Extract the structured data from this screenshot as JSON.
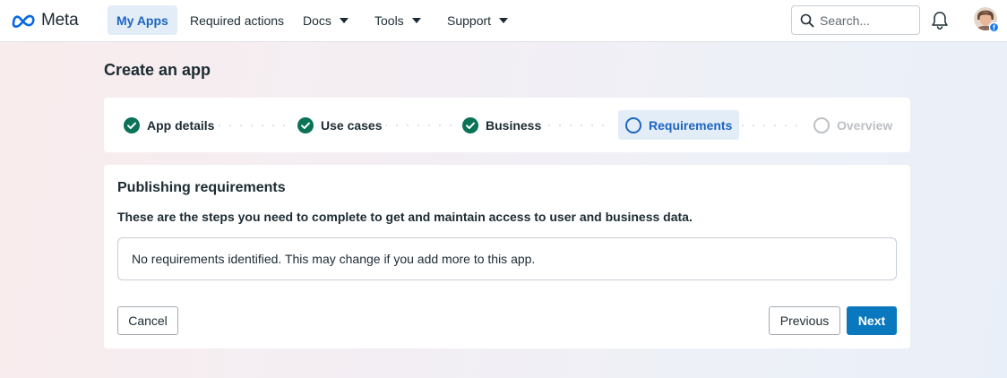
{
  "nav": {
    "brand": "Meta",
    "items": [
      {
        "label": "My Apps"
      },
      {
        "label": "Required actions"
      },
      {
        "label": "Docs"
      },
      {
        "label": "Tools"
      },
      {
        "label": "Support"
      }
    ],
    "search_placeholder": "Search..."
  },
  "page": {
    "title": "Create an app"
  },
  "steps": [
    {
      "label": "App details",
      "state": "done"
    },
    {
      "label": "Use cases",
      "state": "done"
    },
    {
      "label": "Business",
      "state": "done"
    },
    {
      "label": "Requirements",
      "state": "current"
    },
    {
      "label": "Overview",
      "state": "future"
    }
  ],
  "requirements": {
    "title": "Publishing requirements",
    "description": "These are the steps you need to complete to get and maintain access to user and business data.",
    "notice": "No requirements identified. This may change if you add more to this app."
  },
  "actions": {
    "cancel": "Cancel",
    "previous": "Previous",
    "next": "Next"
  },
  "colors": {
    "primary": "#0a78be",
    "active_nav_bg": "#e3edf7",
    "active_text": "#1d65c1",
    "step_done": "#0a7257",
    "step_future": "#bcc0c4"
  }
}
